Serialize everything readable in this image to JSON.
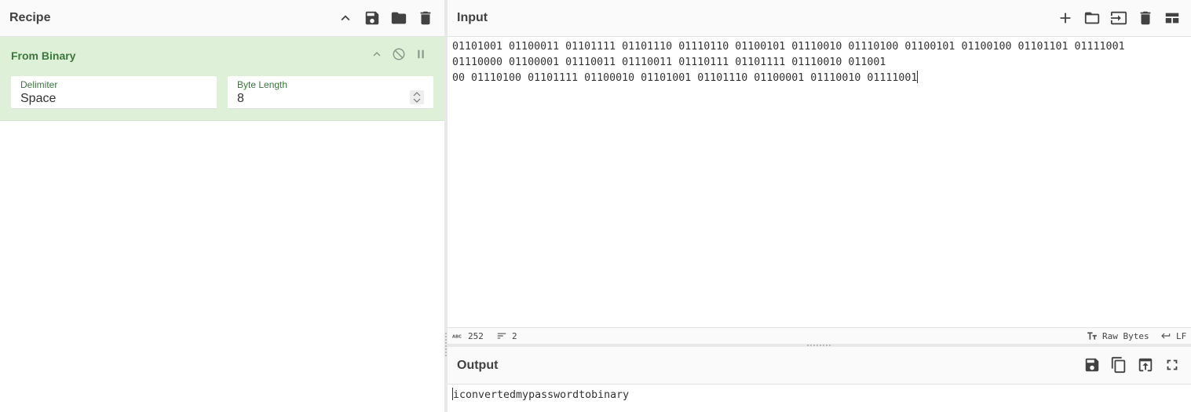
{
  "recipe": {
    "title": "Recipe",
    "icons": [
      "chevron-up-icon",
      "save-icon",
      "folder-icon",
      "trash-icon"
    ],
    "operation": {
      "name": "From Binary",
      "delimiter_label": "Delimiter",
      "delimiter_value": "Space",
      "byte_length_label": "Byte Length",
      "byte_length_value": "8"
    }
  },
  "input": {
    "title": "Input",
    "lines": [
      "01101001 01100011 01101111 01101110 01110110 01100101 01110010 01110100 01100101 01100100 01101101 01111001",
      "01110000 01100001 01110011 01110011 01110111 01101111 01110010 011001",
      "00 01110100 01101111 01100010 01101001 01101110 01100001 01110010 01111001"
    ],
    "status": {
      "length": "252",
      "lines": "2",
      "encoding": "Raw Bytes",
      "eol": "LF"
    }
  },
  "output": {
    "title": "Output",
    "text": "iconvertedmypasswordtobinary"
  },
  "colors": {
    "operation_bg": "#dff0d8",
    "operation_text": "#3c763d",
    "header_bg": "#fafafa"
  }
}
